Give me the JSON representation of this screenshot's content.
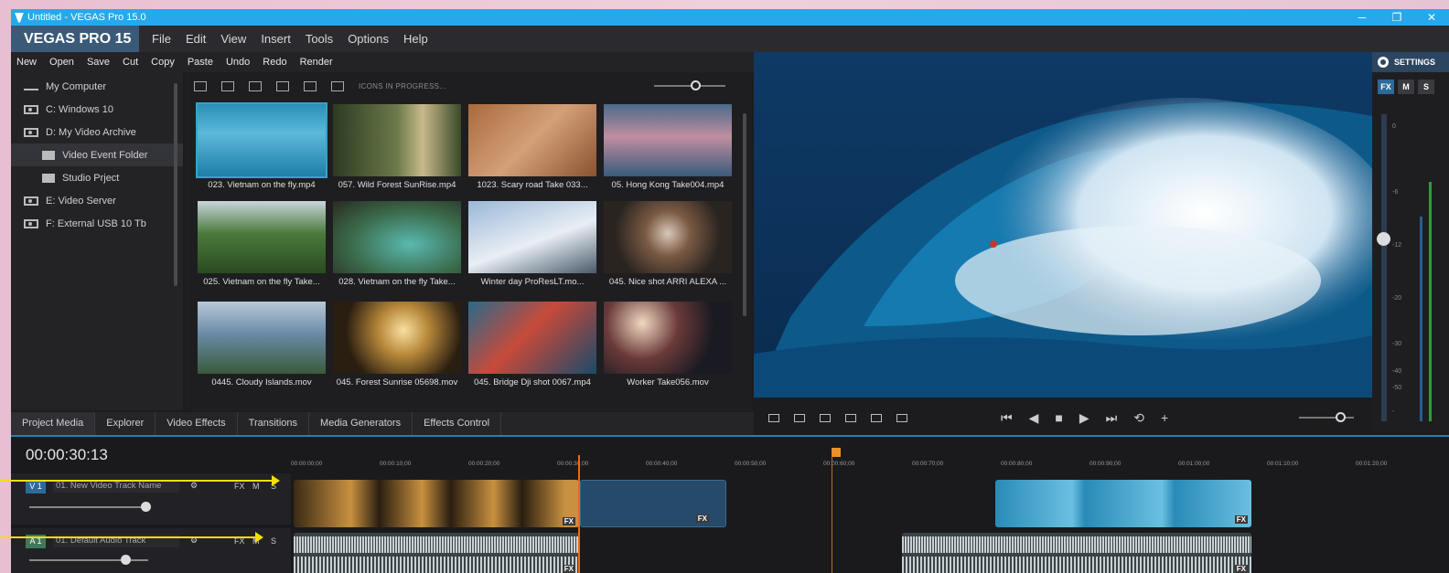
{
  "window": {
    "title": "Untitled - VEGAS Pro 15.0",
    "controls": [
      "─",
      "❐",
      "✕"
    ]
  },
  "brand": "VEGAS PRO 15",
  "menu": [
    "File",
    "Edit",
    "View",
    "Insert",
    "Tools",
    "Options",
    "Help"
  ],
  "toolbar": [
    "New",
    "Open",
    "Save",
    "Cut",
    "Copy",
    "Paste",
    "Undo",
    "Redo",
    "Render"
  ],
  "explorer": [
    {
      "label": "My Computer",
      "icon": "computer-icon"
    },
    {
      "label": "C:  Windows 10",
      "icon": "drive-icon"
    },
    {
      "label": "D:  My Video Archive",
      "icon": "drive-icon"
    },
    {
      "label": "Video Event Folder",
      "icon": "folder-icon"
    },
    {
      "label": "Studio Prject",
      "icon": "folder-icon"
    },
    {
      "label": "E:  Video Server",
      "icon": "drive-icon"
    },
    {
      "label": "F:  External USB 10 Tb",
      "icon": "drive-icon"
    }
  ],
  "media_toolbar": {
    "status": "ICONS IN PROGRESS..."
  },
  "media": [
    "023. Vietnam on the fly.mp4",
    "057. Wild Forest SunRise.mp4",
    "1023. Scary road Take 033...",
    "05. Hong Kong Take004.mp4",
    "025. Vietnam on the fly Take...",
    "028. Vietnam on the fly Take...",
    "Winter day ProResLT.mo...",
    "045. Nice shot ARRI ALEXA ...",
    "0445. Cloudy Islands.mov",
    "045. Forest Sunrise 05698.mov",
    "045. Bridge Dji shot 0067.mp4",
    "Worker Take056.mov"
  ],
  "tabs": [
    "Project Media",
    "Explorer",
    "Video Effects",
    "Transitions",
    "Media Generators",
    "Effects Control"
  ],
  "settings": {
    "title": "SETTINGS",
    "buttons": [
      "FX",
      "M",
      "S"
    ],
    "meter_labels": [
      "0",
      "-6",
      "-12",
      "-20",
      "-30",
      "-40",
      "-50",
      "-"
    ]
  },
  "timeline": {
    "timecode": "00:00:30:13",
    "ruler": [
      "00:00:00;00",
      "00:00:10;00",
      "00:00:20;00",
      "00:00:30;00",
      "00:00:40;00",
      "00:00:50;00",
      "00:00:60;00",
      "00:00:70;00",
      "00:00:80;00",
      "00:00:90;00",
      "00:01:00;00",
      "00:01:10;00",
      "00:01:20;00"
    ],
    "tracks": [
      {
        "num": "V 1",
        "name": "01. New Video Track Name",
        "buttons": [
          "FX",
          "M",
          "S"
        ]
      },
      {
        "num": "A 1",
        "name": "01. Default Audio Track",
        "buttons": [
          "FX",
          "M",
          "S"
        ]
      }
    ],
    "fx_label": "FX"
  },
  "colors": {
    "accent": "#27a8ec",
    "playhead": "#e86a1a",
    "arrow": "#f2e000"
  }
}
